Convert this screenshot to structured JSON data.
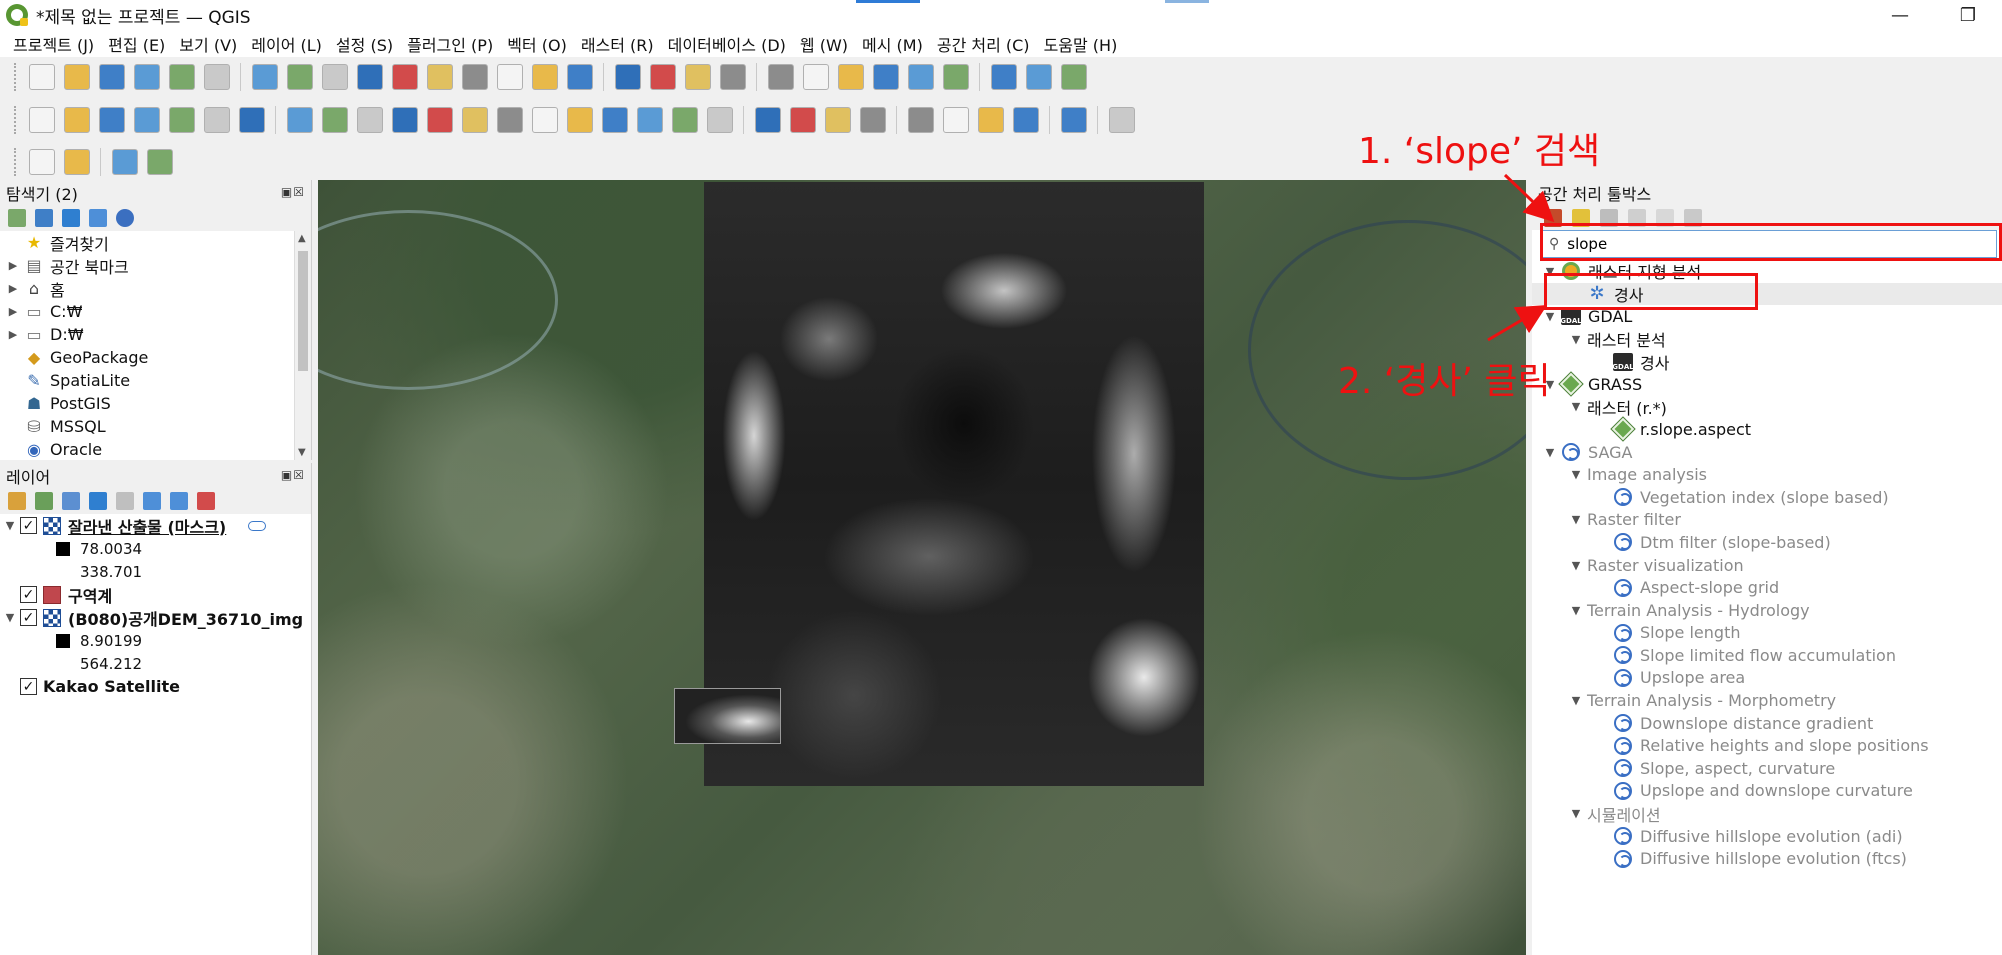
{
  "window": {
    "title": "*제목 없는 프로젝트 — QGIS",
    "minimize": "—",
    "restore": "❐"
  },
  "menubar": [
    "프로젝트 (J)",
    "편집 (E)",
    "보기 (V)",
    "레이어 (L)",
    "설정 (S)",
    "플러그인 (P)",
    "벡터 (O)",
    "래스터 (R)",
    "데이터베이스 (D)",
    "웹 (W)",
    "메시 (M)",
    "공간 처리 (C)",
    "도움말 (H)"
  ],
  "colors": {
    "qgis_green": "#589632",
    "qgis_yellow": "#eec218",
    "annotation_red": "#ee1111",
    "selection_blue": "#6a9fd6"
  },
  "browser_panel": {
    "title": "탐색기 (2)",
    "header_buttons": "▣☒",
    "items": [
      {
        "label": "즐겨찾기",
        "icon": "star-icon",
        "expander": false
      },
      {
        "label": "공간 북마크",
        "icon": "bookmark-icon",
        "expander": true
      },
      {
        "label": "홈",
        "icon": "home-icon",
        "expander": true
      },
      {
        "label": "C:₩",
        "icon": "folder-icon",
        "expander": true
      },
      {
        "label": "D:₩",
        "icon": "folder-icon",
        "expander": true
      },
      {
        "label": "GeoPackage",
        "icon": "geopackage-icon",
        "expander": false
      },
      {
        "label": "SpatiaLite",
        "icon": "spatialite-icon",
        "expander": false
      },
      {
        "label": "PostGIS",
        "icon": "postgis-icon",
        "expander": false
      },
      {
        "label": "MSSQL",
        "icon": "mssql-icon",
        "expander": false
      },
      {
        "label": "Oracle",
        "icon": "oracle-icon",
        "expander": false
      }
    ]
  },
  "layers_panel": {
    "title": "레이어",
    "header_buttons": "▣☒",
    "layers": [
      {
        "name": "잘라낸 산출물 (마스크)",
        "checked": true,
        "icon": "raster-icon",
        "expanded": true,
        "legend_min": "78.0034",
        "legend_max": "338.701"
      },
      {
        "name": "구역계",
        "checked": true,
        "icon": "polygon-icon",
        "expanded": false
      },
      {
        "name": "(B080)공개DEM_36710_img",
        "checked": true,
        "icon": "raster-icon",
        "expanded": true,
        "legend_min": "8.90199",
        "legend_max": "564.212"
      },
      {
        "name": "Kakao Satellite",
        "checked": true,
        "icon": "none",
        "expanded": false
      }
    ]
  },
  "toolbox": {
    "title": "공간 처리 툴박스",
    "search_value": "slope",
    "tree": [
      {
        "level": 0,
        "label": "래스터 지형 분석",
        "icon": "qgis-icon",
        "expander": "▼",
        "gray": false,
        "selected": false
      },
      {
        "level": 1,
        "label": "경사",
        "icon": "gear-icon",
        "expander": "",
        "gray": false,
        "selected": true
      },
      {
        "level": 0,
        "label": "GDAL",
        "icon": "gdal-icon",
        "expander": "▼",
        "gray": false,
        "selected": false
      },
      {
        "level": 1,
        "label": "래스터 분석",
        "icon": "none",
        "expander": "▼",
        "gray": false,
        "selected": false
      },
      {
        "level": 2,
        "label": "경사",
        "icon": "gdal-icon",
        "expander": "",
        "gray": false,
        "selected": false
      },
      {
        "level": 0,
        "label": "GRASS",
        "icon": "grass-icon",
        "expander": "▼",
        "gray": false,
        "selected": false
      },
      {
        "level": 1,
        "label": "래스터 (r.*)",
        "icon": "none",
        "expander": "▼",
        "gray": false,
        "selected": false
      },
      {
        "level": 2,
        "label": "r.slope.aspect",
        "icon": "grass-icon",
        "expander": "",
        "gray": false,
        "selected": false
      },
      {
        "level": 0,
        "label": "SAGA",
        "icon": "saga-icon",
        "expander": "▼",
        "gray": true,
        "selected": false
      },
      {
        "level": 1,
        "label": "Image analysis",
        "icon": "none",
        "expander": "▼",
        "gray": true,
        "selected": false
      },
      {
        "level": 2,
        "label": "Vegetation index (slope based)",
        "icon": "saga-icon",
        "expander": "",
        "gray": true,
        "selected": false
      },
      {
        "level": 1,
        "label": "Raster filter",
        "icon": "none",
        "expander": "▼",
        "gray": true,
        "selected": false
      },
      {
        "level": 2,
        "label": "Dtm filter (slope-based)",
        "icon": "saga-icon",
        "expander": "",
        "gray": true,
        "selected": false
      },
      {
        "level": 1,
        "label": "Raster visualization",
        "icon": "none",
        "expander": "▼",
        "gray": true,
        "selected": false
      },
      {
        "level": 2,
        "label": "Aspect-slope grid",
        "icon": "saga-icon",
        "expander": "",
        "gray": true,
        "selected": false
      },
      {
        "level": 1,
        "label": "Terrain Analysis - Hydrology",
        "icon": "none",
        "expander": "▼",
        "gray": true,
        "selected": false
      },
      {
        "level": 2,
        "label": "Slope length",
        "icon": "saga-icon",
        "expander": "",
        "gray": true,
        "selected": false
      },
      {
        "level": 2,
        "label": "Slope limited flow accumulation",
        "icon": "saga-icon",
        "expander": "",
        "gray": true,
        "selected": false
      },
      {
        "level": 2,
        "label": "Upslope area",
        "icon": "saga-icon",
        "expander": "",
        "gray": true,
        "selected": false
      },
      {
        "level": 1,
        "label": "Terrain Analysis - Morphometry",
        "icon": "none",
        "expander": "▼",
        "gray": true,
        "selected": false
      },
      {
        "level": 2,
        "label": "Downslope distance gradient",
        "icon": "saga-icon",
        "expander": "",
        "gray": true,
        "selected": false
      },
      {
        "level": 2,
        "label": "Relative heights and slope positions",
        "icon": "saga-icon",
        "expander": "",
        "gray": true,
        "selected": false
      },
      {
        "level": 2,
        "label": "Slope, aspect, curvature",
        "icon": "saga-icon",
        "expander": "",
        "gray": true,
        "selected": false
      },
      {
        "level": 2,
        "label": "Upslope and downslope curvature",
        "icon": "saga-icon",
        "expander": "",
        "gray": true,
        "selected": false
      },
      {
        "level": 1,
        "label": "시뮬레이션",
        "icon": "none",
        "expander": "▼",
        "gray": true,
        "selected": false
      },
      {
        "level": 2,
        "label": "Diffusive hillslope evolution (adi)",
        "icon": "saga-icon",
        "expander": "",
        "gray": true,
        "selected": false
      },
      {
        "level": 2,
        "label": "Diffusive hillslope evolution (ftcs)",
        "icon": "saga-icon",
        "expander": "",
        "gray": true,
        "selected": false
      }
    ]
  },
  "annotations": {
    "step1": "1. ‘slope’ 검색",
    "step2": "2. ‘경사’ 클릭"
  }
}
